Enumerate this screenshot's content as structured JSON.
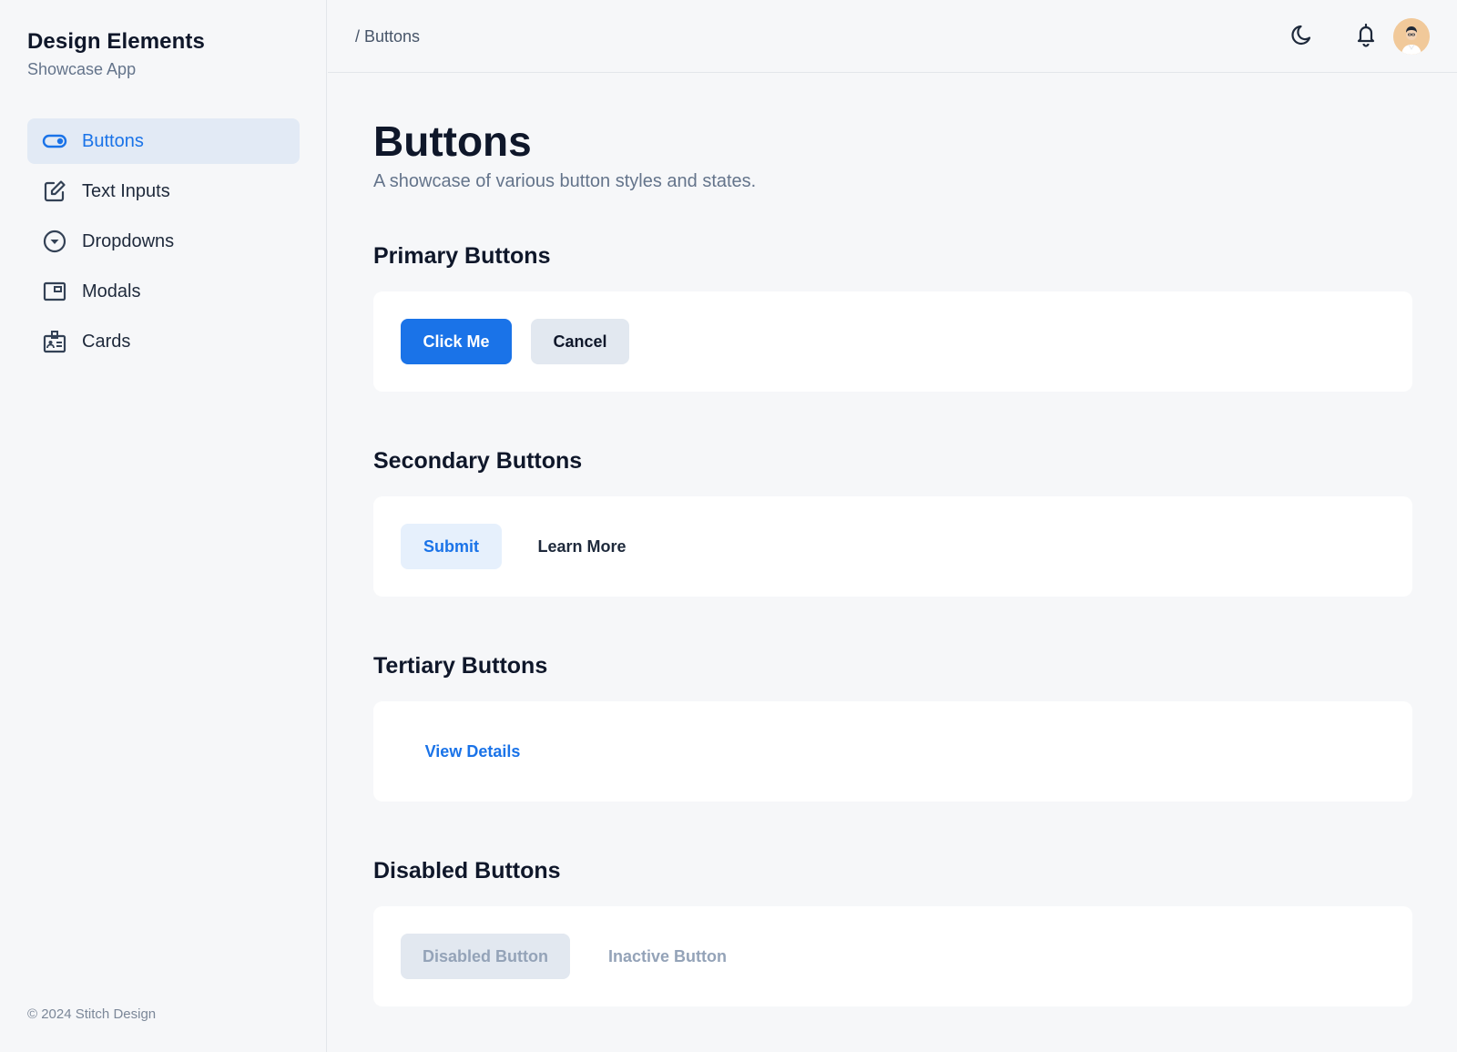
{
  "sidebar": {
    "brand_title": "Design Elements",
    "brand_subtitle": "Showcase App",
    "items": [
      {
        "label": "Buttons",
        "icon": "toggle-icon",
        "active": true
      },
      {
        "label": "Text Inputs",
        "icon": "edit-square-icon",
        "active": false
      },
      {
        "label": "Dropdowns",
        "icon": "circle-caret-down-icon",
        "active": false
      },
      {
        "label": "Modals",
        "icon": "window-icon",
        "active": false
      },
      {
        "label": "Cards",
        "icon": "id-card-icon",
        "active": false
      }
    ],
    "footer": "© 2024 Stitch Design"
  },
  "topbar": {
    "breadcrumb": "/ Buttons",
    "icons": [
      "moon-icon",
      "bell-icon",
      "avatar"
    ]
  },
  "main": {
    "title": "Buttons",
    "subtitle": "A showcase of various button styles and states.",
    "sections": [
      {
        "title": "Primary Buttons",
        "buttons": [
          "Click Me",
          "Cancel"
        ]
      },
      {
        "title": "Secondary Buttons",
        "buttons": [
          "Submit",
          "Learn More"
        ]
      },
      {
        "title": "Tertiary Buttons",
        "buttons": [
          "View Details"
        ]
      },
      {
        "title": "Disabled Buttons",
        "buttons": [
          "Disabled Button",
          "Inactive Button"
        ]
      }
    ]
  },
  "colors": {
    "accent": "#1a73e8",
    "active_nav_bg": "#e2eaf5",
    "background": "#f6f7f9",
    "panel": "#ffffff",
    "muted_text": "#64748b"
  }
}
